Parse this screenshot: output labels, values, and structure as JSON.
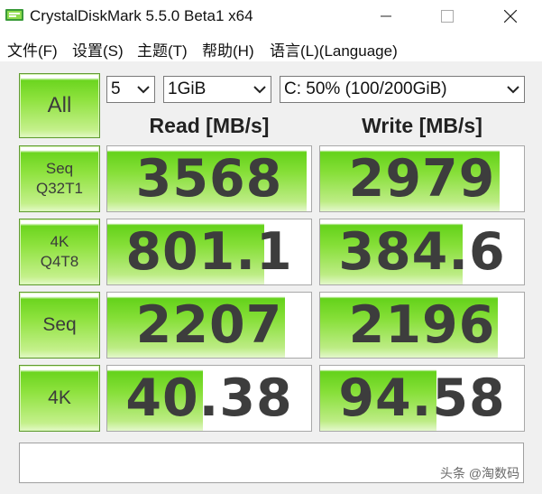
{
  "window": {
    "title": "CrystalDiskMark 5.5.0 Beta1 x64"
  },
  "menu": [
    "文件(F)",
    "设置(S)",
    "主题(T)",
    "帮助(H)",
    "语言(L)(Language)"
  ],
  "controls": {
    "all_label": "All",
    "count": "5",
    "size": "1GiB",
    "drive": "C: 50% (100/200GiB)"
  },
  "headers": {
    "read": "Read [MB/s]",
    "write": "Write [MB/s]"
  },
  "rows": [
    {
      "label_line1": "Seq",
      "label_line2": "Q32T1",
      "read": "3568",
      "write": "2979",
      "read_fill": 0.98,
      "write_fill": 0.88
    },
    {
      "label_line1": "4K",
      "label_line2": "Q4T8",
      "read": "801.1",
      "write": "384.6",
      "read_fill": 0.77,
      "write_fill": 0.7
    },
    {
      "label_line1": "Seq",
      "label_line2": "",
      "read": "2207",
      "write": "2196",
      "read_fill": 0.87,
      "write_fill": 0.87
    },
    {
      "label_line1": "4K",
      "label_line2": "",
      "read": "40.38",
      "write": "94.58",
      "read_fill": 0.47,
      "write_fill": 0.57
    }
  ],
  "status_text": "",
  "watermark": "头条 @淘数码",
  "colors": {
    "accent_green": "#6cd51f",
    "value_text": "#3d3d3d",
    "client_bg": "#f0f0f0"
  }
}
